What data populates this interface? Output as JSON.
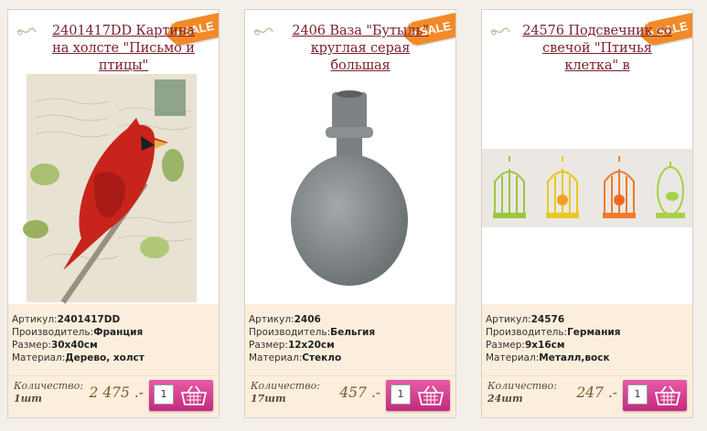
{
  "products": [
    {
      "title": "2401417DD Картина на холсте \"Письмо и птицы\"",
      "sale_label": "SALE",
      "info": {
        "article_label": "Артикул:",
        "article": "2401417DD",
        "maker_label": "Производитель:",
        "maker": "Франция",
        "size_label": "Размер:",
        "size": "30х40см",
        "material_label": "Материал:",
        "material": "Дерево, холст"
      },
      "qty_label": "Количество:",
      "qty_unit": "1шт",
      "price": "2 475 .-",
      "qty_value": "1"
    },
    {
      "title": "2406 Ваза \"Бутыль\" круглая серая большая",
      "sale_label": "SALE",
      "info": {
        "article_label": "Артикул:",
        "article": "2406",
        "maker_label": "Производитель:",
        "maker": "Бельгия",
        "size_label": "Размер:",
        "size": "12х20см",
        "material_label": "Материал:",
        "material": "Стекло"
      },
      "qty_label": "Количество:",
      "qty_unit": "17шт",
      "price": "457 .-",
      "qty_value": "1"
    },
    {
      "title": "24576 Подсвечник со свечой \"Птичья клетка\" в",
      "sale_label": "SALE",
      "info": {
        "article_label": "Артикул:",
        "article": "24576",
        "maker_label": "Производитель:",
        "maker": "Германия",
        "size_label": "Размер:",
        "size": "9х16см",
        "material_label": "Материал:",
        "material": "Металл,воск"
      },
      "qty_label": "Количество:",
      "qty_unit": "24шт",
      "price": "247 .-",
      "qty_value": "1"
    }
  ],
  "colors": {
    "title": "#7a1f2b",
    "sale": "#f28a28",
    "info_bg": "#fbeedd",
    "button": "#c42a7e"
  },
  "icons": {
    "sale": "sale-tag-icon",
    "basket": "basket-icon",
    "decor": "swirl-icon"
  }
}
